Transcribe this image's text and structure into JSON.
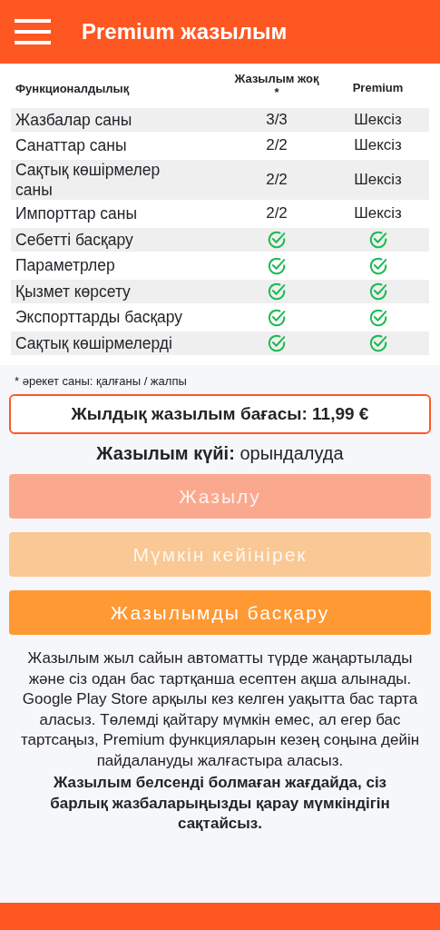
{
  "app_bar": {
    "title": "Premium жазылым"
  },
  "table": {
    "columns": [
      "Функционалдылық",
      "Жазылым жоқ *",
      "Premium"
    ],
    "rows": [
      {
        "feature": "Жазбалар саны",
        "free": {
          "kind": "text",
          "text": "3/3"
        },
        "premium": {
          "kind": "text",
          "text": "Шексіз"
        }
      },
      {
        "feature": "Санаттар саны",
        "free": {
          "kind": "text",
          "text": "2/2"
        },
        "premium": {
          "kind": "text",
          "text": "Шексіз"
        }
      },
      {
        "feature": "Сақтық көшірмелер саны",
        "free": {
          "kind": "text",
          "text": "2/2"
        },
        "premium": {
          "kind": "text",
          "text": "Шексіз"
        }
      },
      {
        "feature": "Импорттар саны",
        "free": {
          "kind": "text",
          "text": "2/2"
        },
        "premium": {
          "kind": "text",
          "text": "Шексіз"
        }
      },
      {
        "feature": "Себетті басқару",
        "free": {
          "kind": "check"
        },
        "premium": {
          "kind": "check"
        }
      },
      {
        "feature": "Параметрлер",
        "free": {
          "kind": "check"
        },
        "premium": {
          "kind": "check"
        }
      },
      {
        "feature": "Қызмет көрсету",
        "free": {
          "kind": "check"
        },
        "premium": {
          "kind": "check"
        }
      },
      {
        "feature": "Экспорттарды басқару",
        "free": {
          "kind": "check"
        },
        "premium": {
          "kind": "check"
        }
      },
      {
        "feature": "Сақтық көшірмелерді",
        "free": {
          "kind": "check"
        },
        "premium": {
          "kind": "check"
        }
      }
    ]
  },
  "footnote": "* әрекет саны: қалғаны / жалпы",
  "price": "Жылдық жазылым бағасы: 11,99 €",
  "status": "**Жазылым күйі:** орындалуда",
  "buttons": [
    {
      "label": "Жазылу",
      "color": "#fba98e",
      "disabled": true
    },
    {
      "label": "Мүмкін кейінірек",
      "color": "#f9c894",
      "disabled": true
    },
    {
      "label": "Жазылымды басқару",
      "color": "#ff9933",
      "disabled": false
    }
  ],
  "info": "Жазылым жыл сайын автоматты түрде жаңартылады және сіз одан бас тартқанша есептен ақша алынады. Google Play Store арқылы кез келген уақытта бас тарта аласыз. Төлемді қайтару мүмкін емес, ал егер бас тартсаңыз, Premium функцияларын кезең соңына дейін пайдалануды жалғастыра аласыз.",
  "info_bold": "Жазылым белсенді болмаған жағдайда, сіз барлық жазбаларыңызды қарау мүмкіндігін сақтайсыз."
}
